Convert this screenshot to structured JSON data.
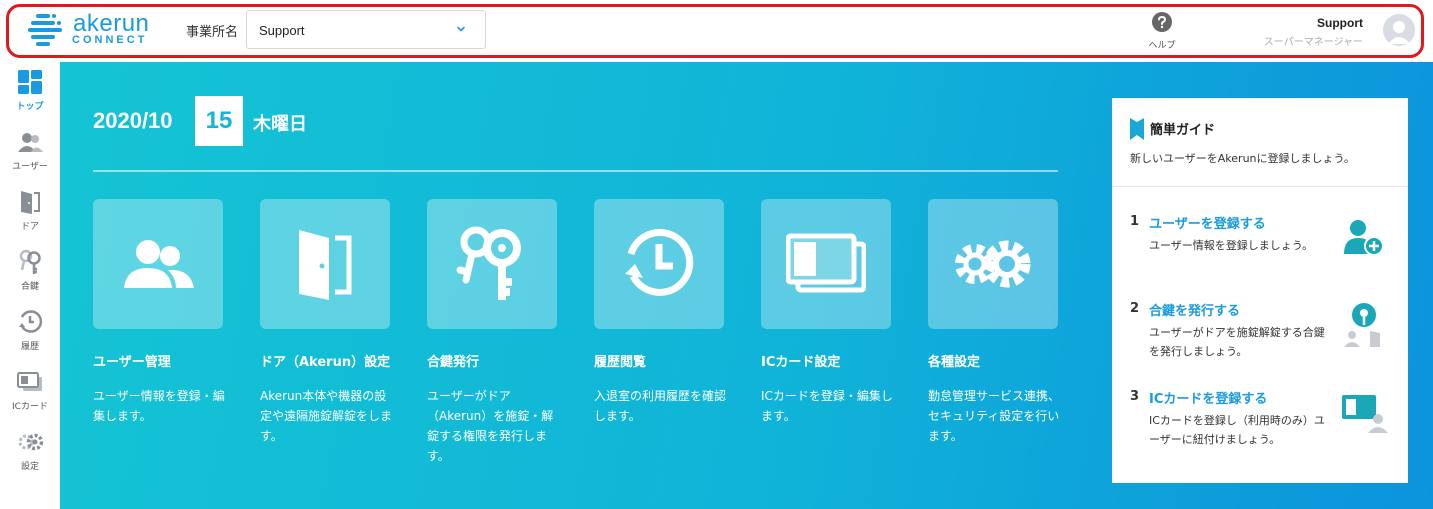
{
  "header": {
    "logo_word": "akerun",
    "logo_sub": "CONNECT",
    "office_label": "事業所名",
    "office_value": "Support",
    "help_label": "ヘルプ",
    "user_name": "Support",
    "user_role": "スーパーマネージャー"
  },
  "sidebar": {
    "items": [
      {
        "label": "トップ",
        "icon": "dashboard-icon"
      },
      {
        "label": "ユーザー",
        "icon": "users-icon"
      },
      {
        "label": "ドア",
        "icon": "door-icon"
      },
      {
        "label": "合鍵",
        "icon": "keys-icon"
      },
      {
        "label": "履歴",
        "icon": "history-icon"
      },
      {
        "label": "ICカード",
        "icon": "ic-card-icon"
      },
      {
        "label": "設定",
        "icon": "gear-icon"
      }
    ]
  },
  "date": {
    "year_month": "2020/10",
    "day": "15",
    "weekday": "木曜日"
  },
  "cards": [
    {
      "title": "ユーザー管理",
      "desc": "ユーザー情報を登録・編集します。",
      "icon": "users-icon"
    },
    {
      "title": "ドア（Akerun）設定",
      "desc": "Akerun本体や機器の設定や遠隔施錠解錠をします。",
      "icon": "door-icon"
    },
    {
      "title": "合鍵発行",
      "desc": "ユーザーがドア（Akerun）を施錠・解錠する権限を発行します。",
      "icon": "keys-icon"
    },
    {
      "title": "履歴閲覧",
      "desc": "入退室の利用履歴を確認します。",
      "icon": "history-icon"
    },
    {
      "title": "ICカード設定",
      "desc": "ICカードを登録・編集します。",
      "icon": "ic-card-icon"
    },
    {
      "title": "各種設定",
      "desc": "勤怠管理サービス連携、セキュリティ設定を行います。",
      "icon": "gears-icon"
    }
  ],
  "guide": {
    "title": "簡単ガイド",
    "subtitle": "新しいユーザーをAkerunに登録しましょう。",
    "steps": [
      {
        "num": "1",
        "link": "ユーザーを登録する",
        "desc": "ユーザー情報を登録しましょう。",
        "icon": "add-user-icon"
      },
      {
        "num": "2",
        "link": "合鍵を発行する",
        "desc": "ユーザーがドアを施錠解錠する合鍵を発行しましょう。",
        "icon": "key-user-icon"
      },
      {
        "num": "3",
        "link": "ICカードを登録する",
        "desc": "ICカードを登録し（利用時のみ）ユーザーに紐付けましょう。",
        "icon": "card-user-icon"
      }
    ]
  },
  "colors": {
    "brand": "#1a9be0",
    "accent_teal": "#14c4d4",
    "highlight_border": "#e0191f"
  }
}
